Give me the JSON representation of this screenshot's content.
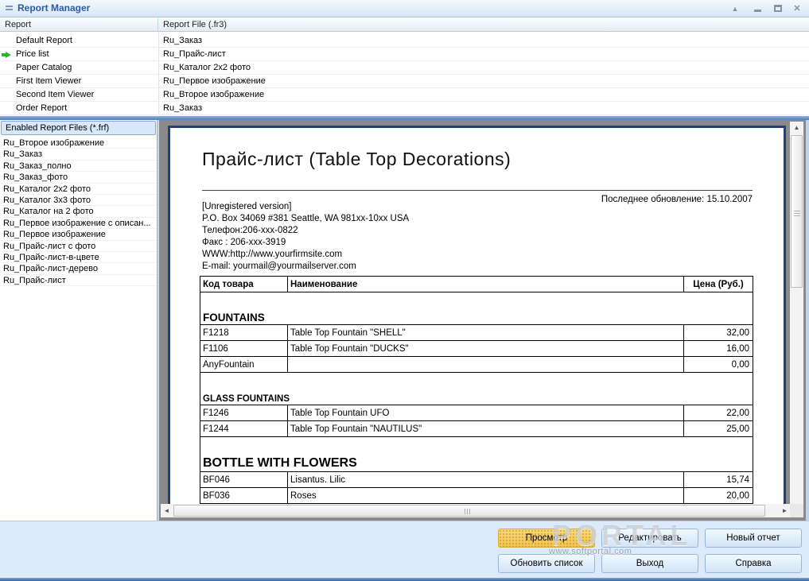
{
  "window": {
    "title": "Report Manager",
    "controls": {
      "rollup": "▲",
      "close": "✕"
    }
  },
  "report_list": {
    "columns": [
      "Report",
      "Report File (.fr3)"
    ],
    "rows": [
      {
        "name": "Default Report",
        "file": "Ru_Заказ",
        "selected": false
      },
      {
        "name": "Price list",
        "file": "Ru_Прайс-лист",
        "selected": true
      },
      {
        "name": "Paper Catalog",
        "file": "Ru_Каталог 2x2 фото",
        "selected": false
      },
      {
        "name": "First Item Viewer",
        "file": "Ru_Первое изображение",
        "selected": false
      },
      {
        "name": "Second Item Viewer",
        "file": "Ru_Второе изображение",
        "selected": false
      },
      {
        "name": "Order Report",
        "file": "Ru_Заказ",
        "selected": false
      }
    ]
  },
  "file_panel": {
    "header": "Enabled Report Files (*.frf)",
    "items": [
      "Ru_Второе изображение",
      "Ru_Заказ",
      "Ru_Заказ_полно",
      "Ru_Заказ_фото",
      "Ru_Каталог 2x2 фото",
      "Ru_Каталог 3x3 фото",
      "Ru_Каталог на 2 фото",
      "Ru_Первое изображение с описан...",
      "Ru_Первое изображение",
      "Ru_Прайс-лист с фото",
      "Ru_Прайс-лист-в-цвете",
      "Ru_Прайс-лист-дерево",
      "Ru_Прайс-лист"
    ]
  },
  "document": {
    "title": "Прайс-лист (Table Top Decorations)",
    "last_update": "Последнее обновление:  15.10.2007",
    "address_lines": [
      "[Unregistered version]",
      "P.O. Box 34069 #381 Seattle, WA 981xx-10xx USA",
      "Телефон:206-xxx-0822",
      "Факс : 206-xxx-3919",
      "WWW:http://www.yourfirmsite.com",
      "E-mail: yourmail@yourmailserver.com"
    ],
    "table": {
      "headers": [
        "Код товара",
        "Наименование",
        "Цена (Руб.)"
      ],
      "rows": [
        {
          "type": "section",
          "label": "FOUNTAINS",
          "size": "md"
        },
        {
          "type": "item",
          "code": "F1218",
          "name": "Table Top Fountain \"SHELL\"",
          "price": "32,00"
        },
        {
          "type": "item",
          "code": "F1106",
          "name": "Table Top Fountain \"DUCKS\"",
          "price": "16,00"
        },
        {
          "type": "item",
          "code": "AnyFountain",
          "name": "",
          "price": "0,00"
        },
        {
          "type": "section",
          "label": "GLASS FOUNTAINS",
          "size": "sm"
        },
        {
          "type": "item",
          "code": "F1246",
          "name": "Table Top Fountain UFO",
          "price": "22,00"
        },
        {
          "type": "item",
          "code": "F1244",
          "name": "Table Top Fountain \"NAUTILUS\"",
          "price": "25,00"
        },
        {
          "type": "section",
          "label": "BOTTLE WITH FLOWERS",
          "size": "lg"
        },
        {
          "type": "item",
          "code": "BF046",
          "name": "Lisantus. Lilic",
          "price": "15,74"
        },
        {
          "type": "item",
          "code": "BF036",
          "name": "Roses",
          "price": "20,00"
        }
      ]
    }
  },
  "buttons": {
    "preview": "Просмотр",
    "edit": "Редактировать",
    "new_report": "Новый отчет",
    "refresh": "Обновить список",
    "exit": "Выход",
    "help": "Справка"
  },
  "watermark": {
    "brand": "PORTAL",
    "url": "www.softportal.com"
  },
  "colors": {
    "accent_title": "#2C5CA8",
    "selection_arrow": "#2DB434",
    "preview_button": "#F2C44D",
    "panel_blue": "#DDEAF9",
    "page_border": "#20407C"
  }
}
